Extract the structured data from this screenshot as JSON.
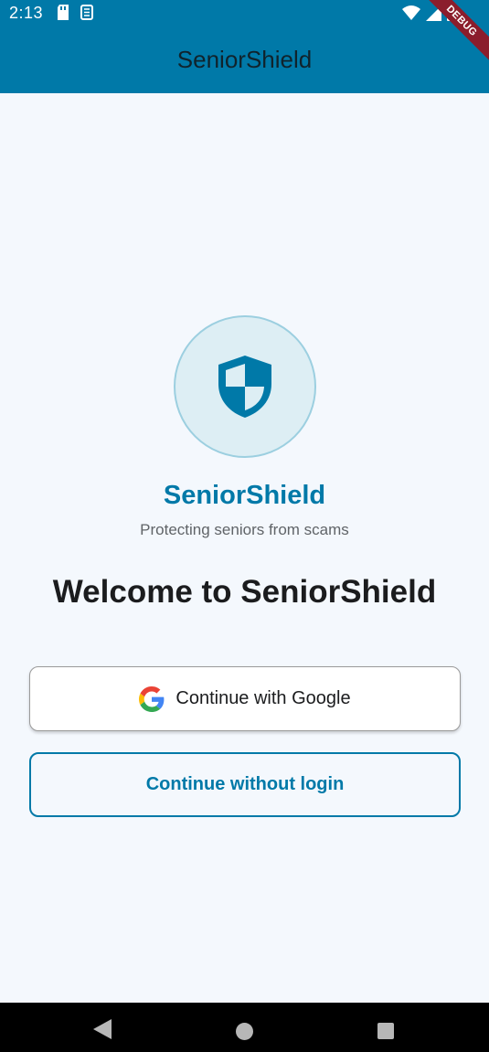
{
  "status_bar": {
    "time": "2:13",
    "left_icons": [
      "sd-card-icon",
      "sim-icon"
    ],
    "right_icons": [
      "wifi-icon",
      "signal-icon",
      "battery-icon"
    ]
  },
  "app_bar": {
    "title": "SeniorShield",
    "debug_banner": "DEBUG"
  },
  "hero": {
    "logo_icon": "shield-icon",
    "brand_name": "SeniorShield",
    "tagline": "Protecting seniors from scams",
    "welcome": "Welcome to SeniorShield"
  },
  "actions": {
    "google_label": "Continue with Google",
    "google_icon": "google-icon",
    "guest_label": "Continue without login"
  },
  "nav": {
    "icons": [
      "back-icon",
      "home-icon",
      "recents-icon"
    ]
  },
  "colors": {
    "primary": "#0079a8",
    "background": "#f4f8fd",
    "logo_fill": "#ddeef4"
  }
}
